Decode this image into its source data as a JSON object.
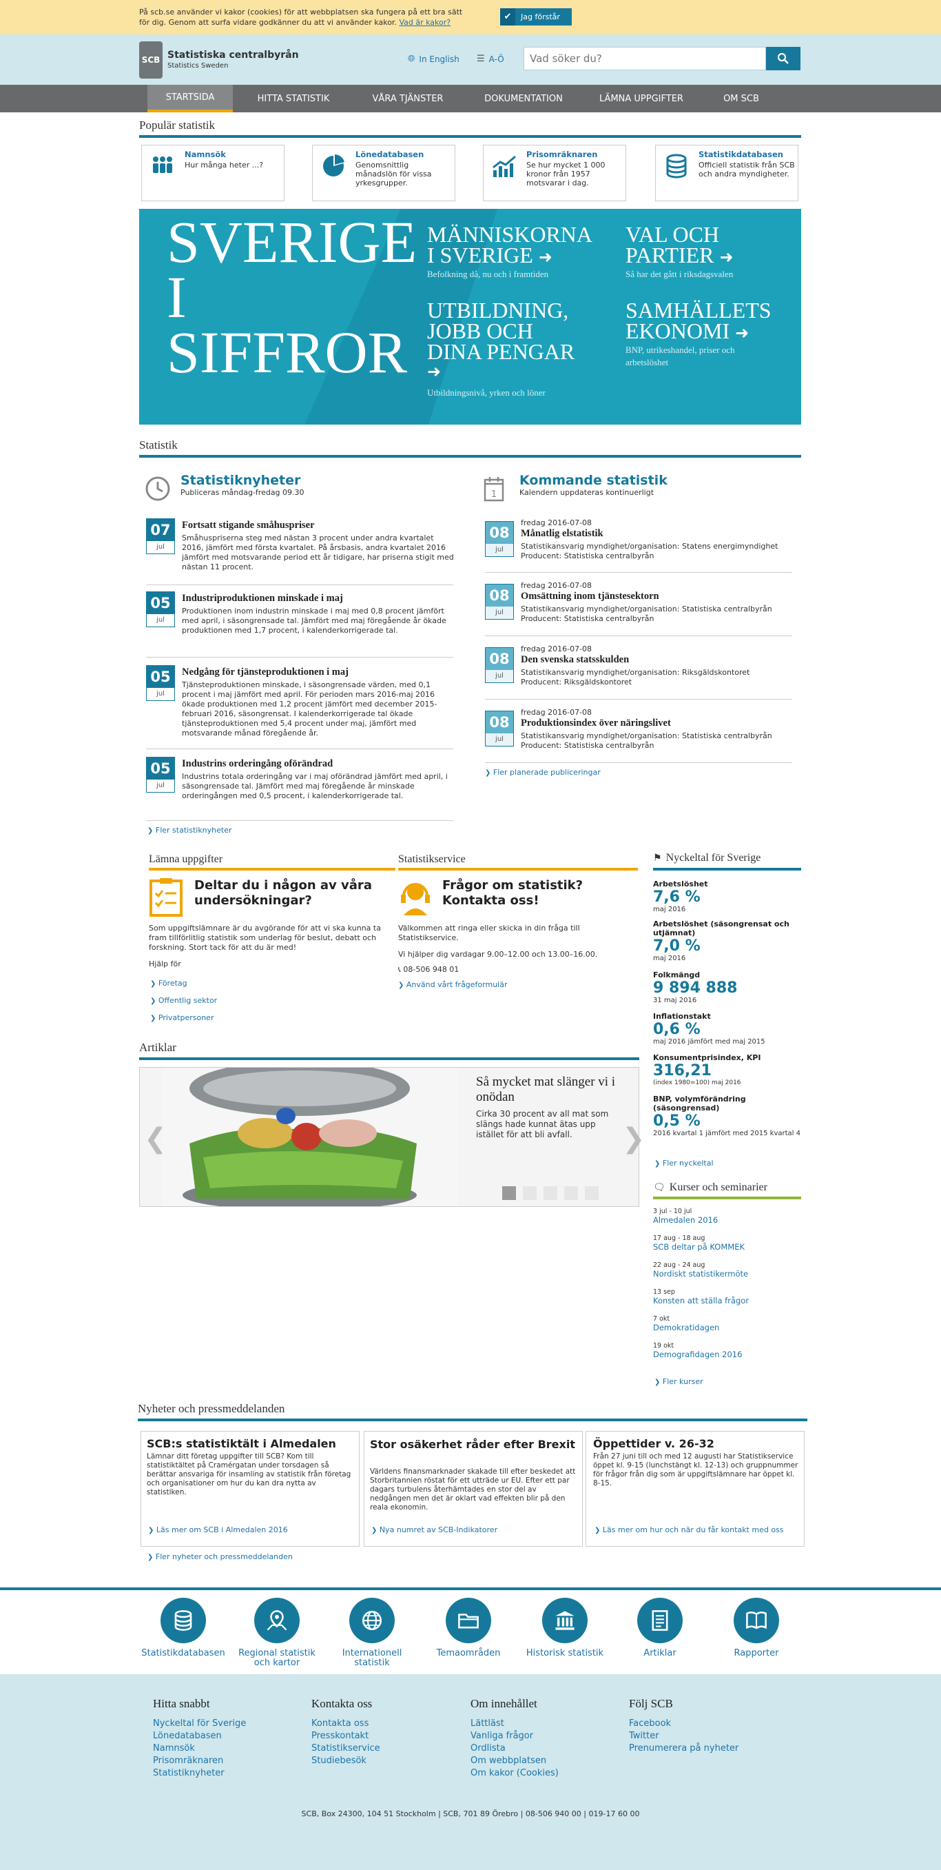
{
  "cookie": {
    "text": "På scb.se använder vi kakor (cookies) för att webbplatsen ska fungera på ett bra sätt för dig. Genom att surfa vidare godkänner du att vi använder kakor.",
    "link": "Vad är kakor?",
    "button": "Jag förstår"
  },
  "header": {
    "logo_mark": "SCB",
    "logo_title": "Statistiska centralbyrån",
    "logo_subtitle": "Statistics Sweden",
    "english": "In English",
    "az": "A-Ö",
    "search_placeholder": "Vad söker du?"
  },
  "nav": [
    "STARTSIDA",
    "HITTA STATISTIK",
    "VÅRA TJÄNSTER",
    "DOKUMENTATION",
    "LÄMNA UPPGIFTER",
    "OM SCB"
  ],
  "popular": {
    "heading": "Populär statistik",
    "items": [
      {
        "title": "Namnsök",
        "desc": "Hur många heter ...?"
      },
      {
        "title": "Lönedatabasen",
        "desc": "Genomsnittlig månadslön för vissa yrkesgrupper."
      },
      {
        "title": "Prisomräknaren",
        "desc": "Se hur mycket 1 000 kronor från 1957 motsvarar i dag."
      },
      {
        "title": "Statistikdatabasen",
        "desc": "Officiell statistik från SCB och andra myndigheter."
      }
    ]
  },
  "hero": {
    "big1": "SVERIGE",
    "big2": "I",
    "big3": "SIFFROR",
    "t1a": "MÄNNISKORNA",
    "t1b": "I SVERIGE",
    "s1": "Befolkning då, nu och i framtiden",
    "t2a": "VAL OCH",
    "t2b": "PARTIER",
    "s2": "Så har det gått i riksdagsvalen",
    "t3a": "UTBILDNING,",
    "t3b": "JOBB OCH",
    "t3c": "DINA PENGAR",
    "s3": "Utbildningsnivå, yrken och löner",
    "t4a": "SAMHÄLLETS",
    "t4b": "EKONOMI",
    "s4a": "BNP, utrikeshandel, priser och",
    "s4b": "arbetslöshet"
  },
  "statistik": {
    "heading": "Statistik",
    "news_title": "Statistiknyheter",
    "news_sub": "Publiceras måndag-fredag 09.30",
    "news": [
      {
        "day": "07",
        "month": "jul",
        "title": "Fortsatt stigande småhuspriser",
        "text": "Småhuspriserna steg med nästan 3 procent under andra kvartalet 2016, jämfört med första kvartalet. På årsbasis, andra kvartalet 2016 jämfört med motsvarande period ett år tidigare, har priserna stigit med nästan 11 procent."
      },
      {
        "day": "05",
        "month": "jul",
        "title": "Industriproduktionen minskade i maj",
        "text": "Produktionen inom industrin minskade i maj med 0,8 procent jämfört med april, i säsongrensade tal. Jämfört med maj föregående år ökade produktionen med 1,7 procent, i kalenderkorrigerade tal."
      },
      {
        "day": "05",
        "month": "jul",
        "title": "Nedgång för tjänsteproduktionen i maj",
        "text": "Tjänsteproduktionen minskade, i säsongrensade värden, med 0,1 procent i maj jämfört med april. För perioden mars 2016-maj 2016 ökade produktionen med 1,2 procent jämfört med december 2015-februari 2016, säsongrensat. I kalenderkorrigerade tal ökade tjänsteproduktionen med 5,4 procent under maj, jämfört med motsvarande månad föregående år."
      },
      {
        "day": "05",
        "month": "jul",
        "title": "Industrins orderingång oförändrad",
        "text": "Industrins totala orderingång var i maj oförändrad jämfört med april, i säsongrensade tal. Jämfört med maj föregående år minskade orderingången med 0,5 procent, i kalenderkorrigerade tal."
      }
    ],
    "news_more": "Fler statistiknyheter",
    "cal_day": "1",
    "upcoming_title": "Kommande statistik",
    "upcoming_sub": "Kalendern uppdateras kontinuerligt",
    "upcoming": [
      {
        "day": "08",
        "month": "jul",
        "date": "fredag 2016-07-08",
        "title": "Månatlig elstatistik",
        "org": "Statistikansvarig myndighet/organisation: Statens energimyndighet",
        "prod": "Producent: Statistiska centralbyrån"
      },
      {
        "day": "08",
        "month": "jul",
        "date": "fredag 2016-07-08",
        "title": "Omsättning inom tjänstesektorn",
        "org": "Statistikansvarig myndighet/organisation: Statistiska centralbyrån",
        "prod": "Producent: Statistiska centralbyrån"
      },
      {
        "day": "08",
        "month": "jul",
        "date": "fredag 2016-07-08",
        "title": "Den svenska statsskulden",
        "org": "Statistikansvarig myndighet/organisation: Riksgäldskontoret",
        "prod": "Producent: Riksgäldskontoret"
      },
      {
        "day": "08",
        "month": "jul",
        "date": "fredag 2016-07-08",
        "title": "Produktionsindex över näringslivet",
        "org": "Statistikansvarig myndighet/organisation: Statistiska centralbyrån",
        "prod": "Producent: Statistiska centralbyrån"
      }
    ],
    "upcoming_more": "Fler planerade publiceringar"
  },
  "lamna": {
    "heading": "Lämna uppgifter",
    "title": "Deltar du i någon av våra undersökningar?",
    "text": "Som uppgiftslämnare är du avgörande för att vi ska kunna ta fram tillförlitlig statistik som underlag för beslut, debatt och forskning. Stort tack för att du är med!",
    "help": "Hjälp för",
    "links": [
      "Företag",
      "Offentlig sektor",
      "Privatpersoner"
    ]
  },
  "service": {
    "heading": "Statistikservice",
    "title": "Frågor om statistik? Kontakta oss!",
    "text": "Välkommen att ringa eller skicka in din fråga till Statistikservice.",
    "hours": "Vi hjälper dig vardagar 9.00–12.00 och 13.00–16.00.",
    "phone": "08-506 948 01",
    "form": "Använd vårt frågeformulär"
  },
  "nyckeltal": {
    "heading": "Nyckeltal för Sverige",
    "items": [
      {
        "label": "Arbetslöshet",
        "value": "7,6 %",
        "sub": "maj 2016"
      },
      {
        "label": "Arbetslöshet (säsongrensat och utjämnat)",
        "value": "7,0 %",
        "sub": "maj 2016"
      },
      {
        "label": "Folkmängd",
        "value": "9 894 888",
        "sub": "31 maj 2016"
      },
      {
        "label": "Inflationstakt",
        "value": "0,6 %",
        "sub": "maj 2016 jämfört med maj 2015"
      },
      {
        "label": "Konsumentprisindex, KPI",
        "value": "316,21",
        "sub1": "(index 1980=100) maj 2016",
        "sub": "maj 2016"
      },
      {
        "label": "BNP, volymförändring (säsongrensad)",
        "value": "0,5 %",
        "sub": "2016 kvartal 1 jämfört med 2015 kvartal 4"
      }
    ],
    "more": "Fler nyckeltal"
  },
  "kurser": {
    "heading": "Kurser och seminarier",
    "items": [
      {
        "date": "3 jul - 10 jul",
        "title": "Almedalen 2016"
      },
      {
        "date": "17 aug - 18 aug",
        "title": "SCB deltar på KOMMEK"
      },
      {
        "date": "22 aug - 24 aug",
        "title": "Nordiskt statistikermöte"
      },
      {
        "date": "13 sep",
        "title": "Konsten att ställa frågor"
      },
      {
        "date": "7 okt",
        "title": "Demokratidagen"
      },
      {
        "date": "19 okt",
        "title": "Demografidagen 2016"
      }
    ],
    "more": "Fler kurser"
  },
  "artiklar": {
    "heading": "Artiklar",
    "title": "Så mycket mat slänger vi i onödan",
    "text": "Cirka 30 procent av all mat som slängs hade kunnat ätas upp istället för att bli avfall."
  },
  "press": {
    "heading": "Nyheter och pressmeddelanden",
    "items": [
      {
        "title": "SCB:s statistiktält i Almedalen",
        "text": "Lämnar ditt företag uppgifter till SCB? Kom till statistiktältet på Cramérgatan under torsdagen så berättar ansvariga för insamling av statistik från företag och organisationer om hur du kan dra nytta av statistiken.",
        "link": "Läs mer om SCB i Almedalen 2016"
      },
      {
        "title": "Stor osäkerhet råder efter Brexit",
        "text": "Världens finansmarknader skakade till efter beskedet att Storbritannien röstat för ett utträde ur EU. Efter ett par dagars turbulens återhämtades en stor del av nedgången men det är oklart vad effekten blir på den reala ekonomin.",
        "link": "Nya numret av SCB-Indikatorer"
      },
      {
        "title": "Öppettider v. 26-32",
        "text": "Från 27 juni till och med 12 augusti har Statistikservice öppet kl. 9-15 (lunchstängt kl. 12-13) och gruppnummer för frågor från dig som är uppgiftslämnare har öppet kl. 8-15.",
        "link": "Läs mer om hur och när du får kontakt med oss"
      }
    ],
    "more": "Fler nyheter och pressmeddelanden"
  },
  "shortcuts": [
    {
      "label1": "Statistikdatabasen",
      "label2": "",
      "icon": "database-icon"
    },
    {
      "label1": "Regional statistik",
      "label2": "och kartor",
      "icon": "map-pin-icon"
    },
    {
      "label1": "Internationell",
      "label2": "statistik",
      "icon": "globe-icon"
    },
    {
      "label1": "Temaområden",
      "label2": "",
      "icon": "folder-icon"
    },
    {
      "label1": "Historisk statistik",
      "label2": "",
      "icon": "building-icon"
    },
    {
      "label1": "Artiklar",
      "label2": "",
      "icon": "document-icon"
    },
    {
      "label1": "Rapporter",
      "label2": "",
      "icon": "book-icon"
    }
  ],
  "footer": {
    "cols": [
      {
        "heading": "Hitta snabbt",
        "links": [
          "Nyckeltal för Sverige",
          "Lönedatabasen",
          "Namnsök",
          "Prisomräknaren",
          "Statistiknyheter"
        ]
      },
      {
        "heading": "Kontakta oss",
        "links": [
          "Kontakta oss",
          "Presskontakt",
          "Statistikservice",
          "Studiebesök"
        ]
      },
      {
        "heading": "Om innehållet",
        "links": [
          "Lättläst",
          "Vanliga frågor",
          "Ordlista",
          "Om webbplatsen",
          "Om kakor (Cookies)"
        ]
      },
      {
        "heading": "Följ SCB",
        "links": [
          "Facebook",
          "Twitter",
          "Prenumerera på nyheter"
        ]
      }
    ],
    "address": "SCB, Box 24300, 104 51 Stockholm | SCB, 701 89 Örebro | 08-506 940 00 | 019-17 60 00"
  },
  "colors": {
    "accent": "#16799c",
    "cookie_bg": "#fbe3a2",
    "header_bg": "#cfe7ed",
    "nav_bg": "#67696b",
    "orange": "#f0a500",
    "green": "#8fb63a"
  }
}
